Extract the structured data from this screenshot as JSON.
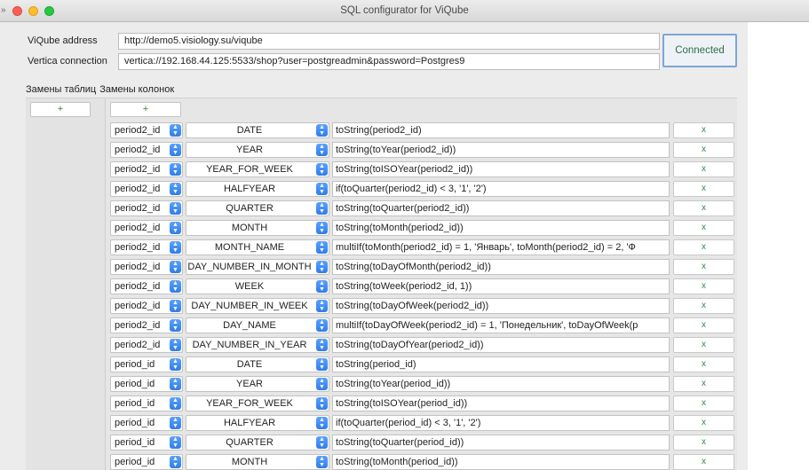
{
  "window": {
    "title": "SQL configurator for ViQube"
  },
  "connection": {
    "viqube_label": "ViQube address",
    "viqube_value": "http://demo5.visiology.su/viqube",
    "vertica_label": "Vertica connection",
    "vertica_value": "vertica://192.168.44.125:5533/shop?user=postgreadmin&password=Postgres9",
    "status_button": "Connected"
  },
  "tabs": [
    "Замены таблиц",
    "Замены колонок"
  ],
  "add_label": "+",
  "remove_label": "x",
  "rows": [
    {
      "table": "period2_id",
      "column": "DATE",
      "expr": "toString(period2_id)"
    },
    {
      "table": "period2_id",
      "column": "YEAR",
      "expr": "toString(toYear(period2_id))"
    },
    {
      "table": "period2_id",
      "column": "YEAR_FOR_WEEK",
      "expr": "toString(toISOYear(period2_id))"
    },
    {
      "table": "period2_id",
      "column": "HALFYEAR",
      "expr": "if(toQuarter(period2_id) < 3, '1', '2')"
    },
    {
      "table": "period2_id",
      "column": "QUARTER",
      "expr": "toString(toQuarter(period2_id))"
    },
    {
      "table": "period2_id",
      "column": "MONTH",
      "expr": "toString(toMonth(period2_id))"
    },
    {
      "table": "period2_id",
      "column": "MONTH_NAME",
      "expr": "multiIf(toMonth(period2_id) = 1, 'Январь', toMonth(period2_id) = 2, 'Ф"
    },
    {
      "table": "period2_id",
      "column": "DAY_NUMBER_IN_MONTH",
      "expr": "toString(toDayOfMonth(period2_id))"
    },
    {
      "table": "period2_id",
      "column": "WEEK",
      "expr": "toString(toWeek(period2_id, 1))"
    },
    {
      "table": "period2_id",
      "column": "DAY_NUMBER_IN_WEEK",
      "expr": "toString(toDayOfWeek(period2_id))"
    },
    {
      "table": "period2_id",
      "column": "DAY_NAME",
      "expr": "multiIf(toDayOfWeek(period2_id) = 1, 'Понедельник', toDayOfWeek(p"
    },
    {
      "table": "period2_id",
      "column": "DAY_NUMBER_IN_YEAR",
      "expr": "toString(toDayOfYear(period2_id))"
    },
    {
      "table": "period_id",
      "column": "DATE",
      "expr": "toString(period_id)"
    },
    {
      "table": "period_id",
      "column": "YEAR",
      "expr": "toString(toYear(period_id))"
    },
    {
      "table": "period_id",
      "column": "YEAR_FOR_WEEK",
      "expr": "toString(toISOYear(period_id))"
    },
    {
      "table": "period_id",
      "column": "HALFYEAR",
      "expr": "if(toQuarter(period_id) < 3, '1', '2')"
    },
    {
      "table": "period_id",
      "column": "QUARTER",
      "expr": "toString(toQuarter(period_id))"
    },
    {
      "table": "period_id",
      "column": "MONTH",
      "expr": "toString(toMonth(period_id))"
    }
  ]
}
